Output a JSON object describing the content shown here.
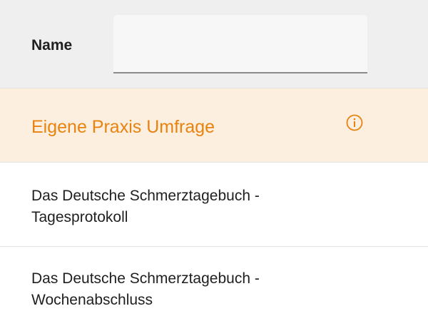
{
  "filter": {
    "label": "Name",
    "value": "",
    "placeholder": ""
  },
  "list": {
    "items": [
      {
        "line1": "Eigene Praxis Umfrage",
        "icon": "info-icon",
        "selected": true
      },
      {
        "line1": "Das Deutsche Schmerztagebuch -",
        "line2": "Tagesprotokoll",
        "selected": false
      },
      {
        "line1": "Das Deutsche Schmerztagebuch -",
        "line2": "Wochenabschluss",
        "selected": false
      }
    ]
  },
  "colors": {
    "selected_background": "#fdefdf",
    "selected_text": "#e8830f",
    "header_background": "#efefef"
  }
}
